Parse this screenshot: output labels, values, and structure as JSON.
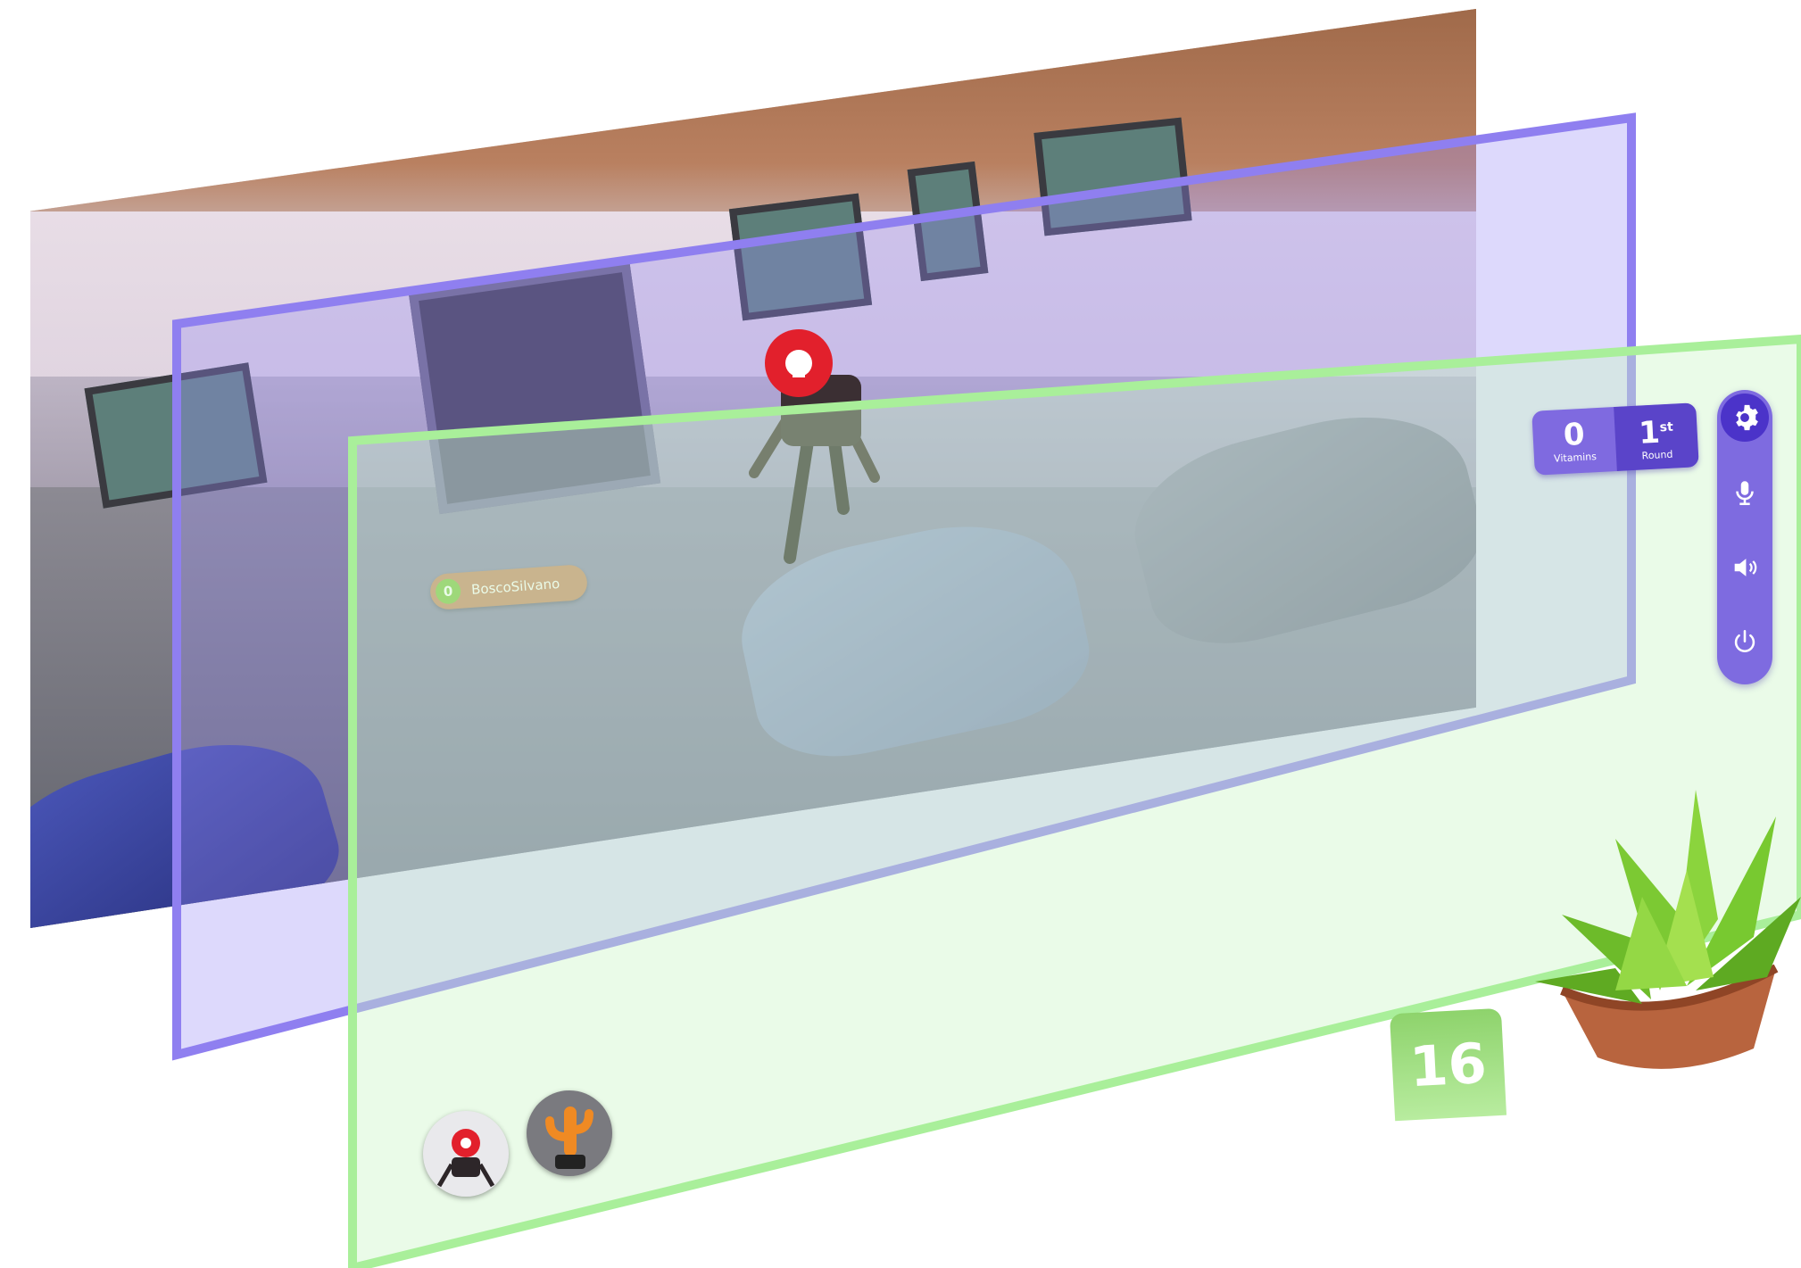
{
  "player": {
    "name": "BoscoSilvano",
    "score": "0"
  },
  "stats": {
    "vitamins_value": "0",
    "vitamins_label": "Vitamins",
    "round_value": "1",
    "round_suffix": "st",
    "round_label": "Round"
  },
  "controls": {
    "items": [
      "gear-icon",
      "microphone-icon",
      "speaker-icon",
      "power-icon"
    ]
  },
  "countdown": {
    "value": "16"
  },
  "avatars": [
    "robot-avatar",
    "cactus-avatar"
  ],
  "colors": {
    "accent_purple": "#7e6be0",
    "dark_purple": "#4b33c9",
    "plane_purple": "#8f7ff0",
    "plane_green": "#a9ef9a",
    "countdown_green": "#8ed36c",
    "tag_orange": "#c78665"
  }
}
